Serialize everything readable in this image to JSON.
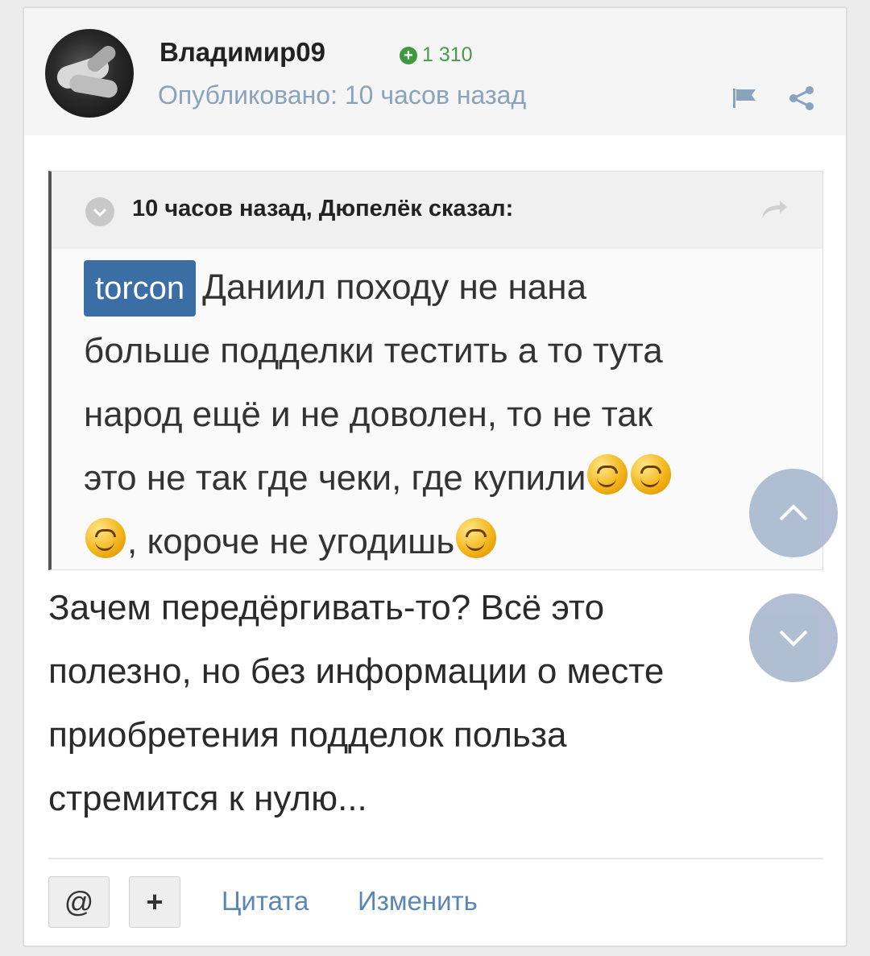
{
  "post": {
    "author": "Владимир09",
    "reputation": "1 310",
    "published": "Опубликовано: 10 часов назад"
  },
  "quote": {
    "header": "10 часов назад, Дюпелёк сказал:",
    "mention": "torcon",
    "text_line1": "Даниил походу не нана",
    "text_line2": "больше подделки тестить а то тута",
    "text_line3": "народ ещё и не доволен, то не так",
    "text_line4": "это не так где чеки, где купили",
    "text_line5": ", короче не угодишь"
  },
  "body": {
    "line1": "Зачем передёргивать-то? Всё это",
    "line2": "полезно, но без информации о месте",
    "line3": "приобретения подделок польза",
    "line4": "стремится к нулю..."
  },
  "actions": {
    "mention_label": "@",
    "multiquote_label": "+",
    "quote_label": "Цитата",
    "edit_label": "Изменить"
  },
  "icons": {
    "reputation": "plus-circle-icon",
    "flag": "flag-icon",
    "share": "share-icon",
    "collapse": "chevron-down-icon",
    "reply": "reply-arrow-icon",
    "scroll_up": "chevron-up-icon",
    "scroll_down": "chevron-down-icon",
    "smiley": "smiley-emoji"
  },
  "colors": {
    "mention_bg": "#3a6ea5",
    "link": "#5a86b8",
    "reputation": "#3e9a3e",
    "float_button": "#aab9cf"
  }
}
